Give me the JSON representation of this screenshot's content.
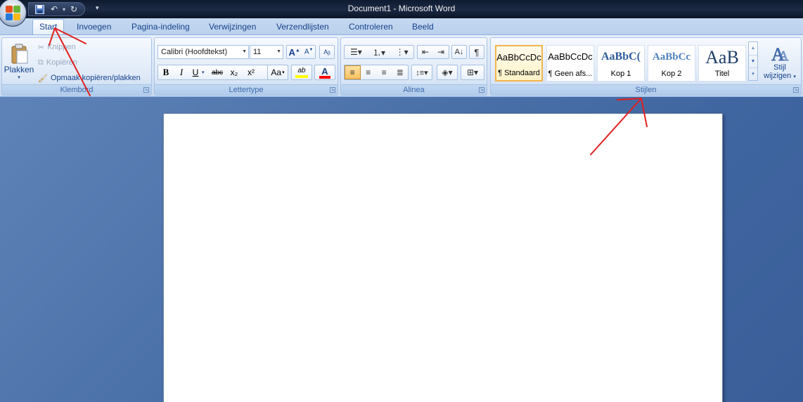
{
  "window": {
    "title": "Document1 - Microsoft Word"
  },
  "quick_access": {
    "save_icon": "save-icon",
    "undo_icon": "undo-icon",
    "redo_icon": "redo-icon",
    "more_icon": "customize-qat-icon"
  },
  "tabs": [
    "Start",
    "Invoegen",
    "Pagina-indeling",
    "Verwijzingen",
    "Verzendlijsten",
    "Controleren",
    "Beeld"
  ],
  "active_tab": "Start",
  "clipboard": {
    "label": "Klembord",
    "paste_label": "Plakken",
    "cut_label": "Knippen",
    "copy_label": "Kopiëren",
    "format_painter_label": "Opmaak kopiëren/plakken"
  },
  "font": {
    "label": "Lettertype",
    "font_name": "Calibri (Hoofdtekst)",
    "font_size": "11",
    "bold": "B",
    "italic": "I",
    "underline": "U",
    "strike": "abc",
    "subscript": "x₂",
    "superscript": "x²",
    "change_case": "Aa",
    "grow": "A",
    "shrink": "A",
    "highlight_label": "ab",
    "font_color_label": "A"
  },
  "paragraph": {
    "label": "Alinea",
    "pilcrow": "¶"
  },
  "styles": {
    "label": "Stijlen",
    "items": [
      {
        "sample": "AaBbCcDc",
        "name": "¶ Standaard"
      },
      {
        "sample": "AaBbCcDc",
        "name": "¶ Geen afs..."
      },
      {
        "sample": "AaBbC(",
        "name": "Kop 1"
      },
      {
        "sample": "AaBbCc",
        "name": "Kop 2"
      },
      {
        "sample": "AaB",
        "name": "Titel"
      }
    ],
    "change_label_1": "Stijl",
    "change_label_2": "wijzigen"
  },
  "colors": {
    "accent": "#f3b44b",
    "ribbon": "#dbe7f6",
    "annotation": "#e02020",
    "highlight": "#ffff00",
    "font_color": "#ff0000"
  }
}
